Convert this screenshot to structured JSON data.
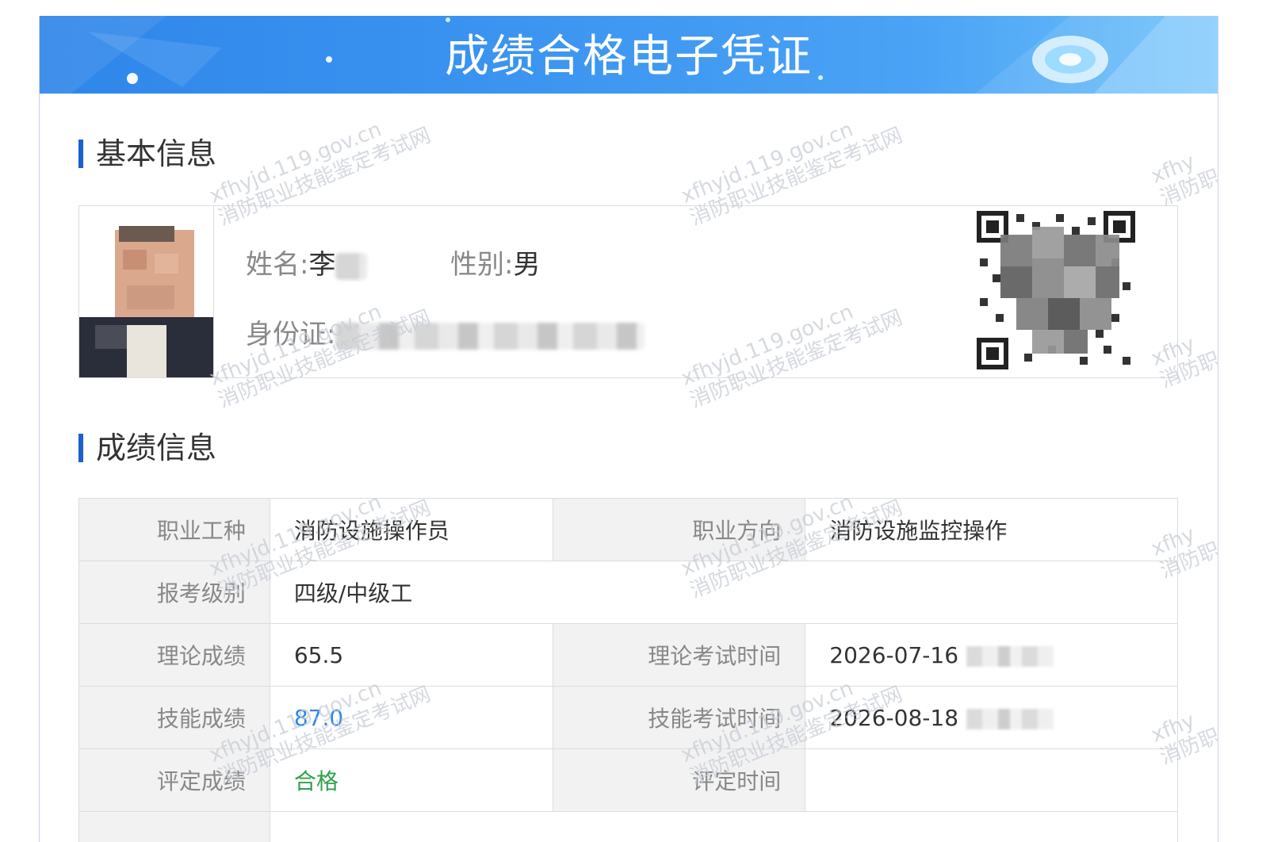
{
  "banner": {
    "title": "成绩合格电子凭证"
  },
  "sections": {
    "basic": "基本信息",
    "scores": "成绩信息"
  },
  "basic": {
    "name_label": "姓名:",
    "name_value": "李",
    "gender_label": "性别:",
    "gender_value": "男",
    "id_label": "身份证:"
  },
  "scores": {
    "occupation_label": "职业工种",
    "occupation_value": "消防设施操作员",
    "direction_label": "职业方向",
    "direction_value": "消防设施监控操作",
    "level_label": "报考级别",
    "level_value": "四级/中级工",
    "theory_label": "理论成绩",
    "theory_value": "65.5",
    "theory_time_label": "理论考试时间",
    "theory_time_value": "2026-07-16",
    "skill_label": "技能成绩",
    "skill_value": "87.0",
    "skill_time_label": "技能考试时间",
    "skill_time_value": "2026-08-18",
    "eval_label": "评定成绩",
    "eval_value": "合格",
    "eval_time_label": "评定时间",
    "eval_time_value": ""
  },
  "watermark": {
    "line1": "xfhyjd.119.gov.cn",
    "line2": "消防职业技能鉴定考试网",
    "line1_short": "xfhy",
    "line2_short": "消防职"
  },
  "colors": {
    "banner": "#3b94f0",
    "accent_bar": "#1b5fd1",
    "score_blue": "#2e87e8",
    "pass_green": "#2ea14a"
  }
}
